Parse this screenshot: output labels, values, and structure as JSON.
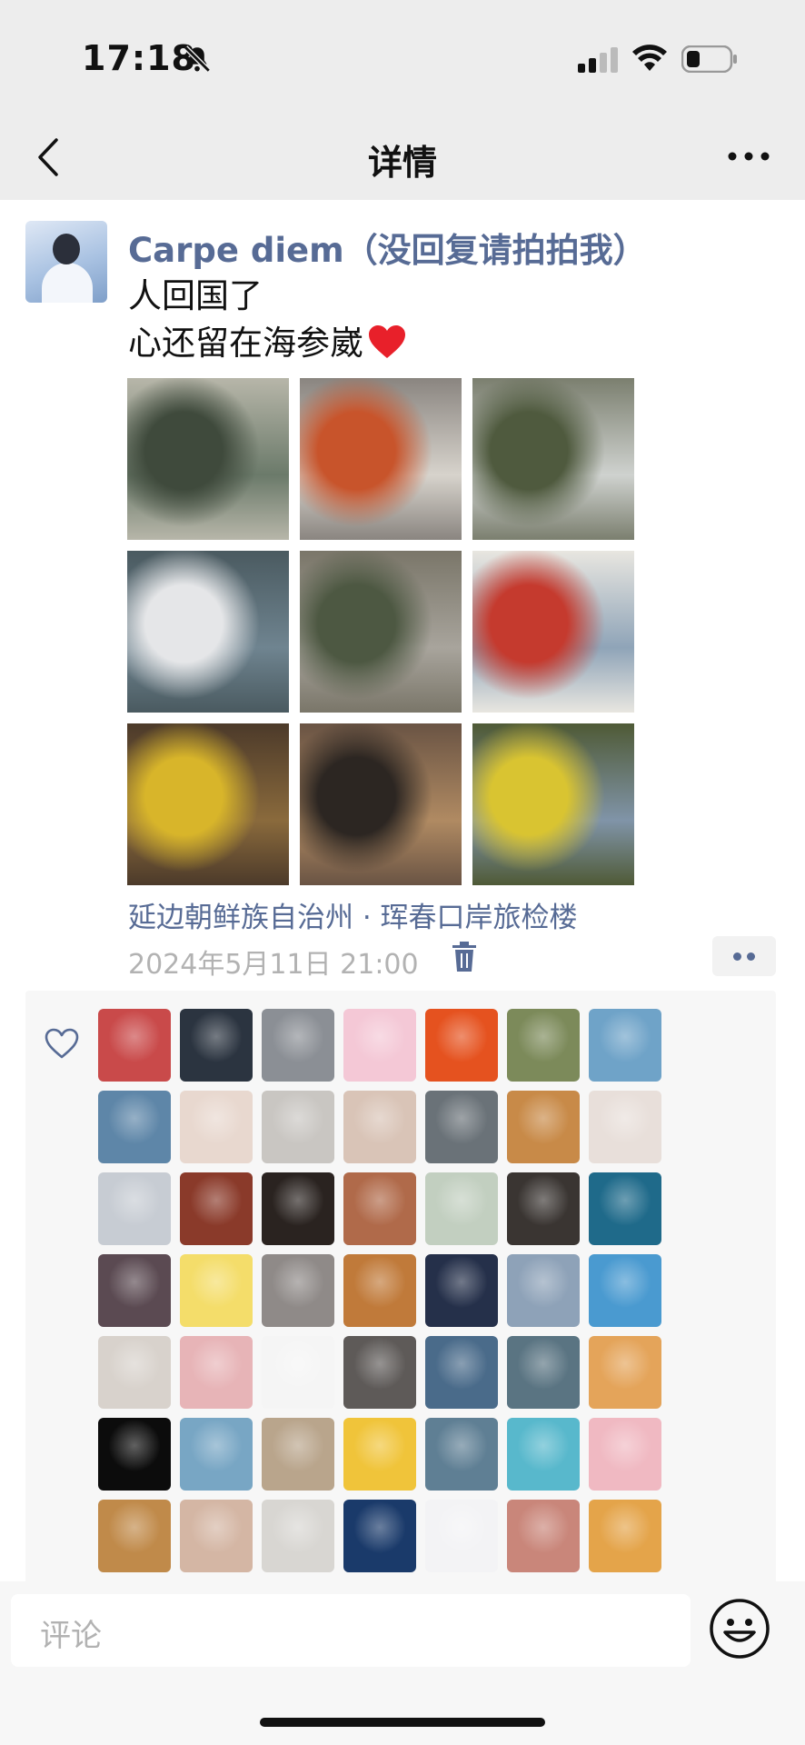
{
  "status_bar": {
    "time": "17:18"
  },
  "nav": {
    "title": "详情"
  },
  "post": {
    "user_name": "Carpe diem（没回复请拍拍我）",
    "text_lines": [
      "人回国了",
      "心还留在海参崴"
    ],
    "location": "延边朝鲜族自治州 · 珲春口岸旅检楼",
    "time": "2024年5月11日 21:00",
    "photos": [
      {
        "name": "soldier-tank-photo",
        "colors": [
          "#6b7a6a",
          "#3f4a3c",
          "#b7b6a9"
        ]
      },
      {
        "name": "crab-legs-photo",
        "colors": [
          "#d7d3cc",
          "#c8542b",
          "#8a8580"
        ]
      },
      {
        "name": "military-truck-photo",
        "colors": [
          "#cfd2cf",
          "#4f5a3e",
          "#7b7f6f"
        ]
      },
      {
        "name": "navy-parade-photo",
        "colors": [
          "#6f8490",
          "#e5e6e8",
          "#4a5a60"
        ]
      },
      {
        "name": "tank-parade-photo",
        "colors": [
          "#a8a49c",
          "#4d5842",
          "#7a7669"
        ]
      },
      {
        "name": "vintage-car-parade-photo",
        "colors": [
          "#8fa4b8",
          "#c53a2e",
          "#e8e6e0"
        ]
      },
      {
        "name": "street-cafe-photo",
        "colors": [
          "#8a6a3c",
          "#d8b52a",
          "#4c3a2a"
        ]
      },
      {
        "name": "woman-leather-jacket-photo",
        "colors": [
          "#b08a62",
          "#2c2622",
          "#6a5444"
        ]
      },
      {
        "name": "scooters-statue-photo",
        "colors": [
          "#8094a8",
          "#d9c431",
          "#4f5a36"
        ]
      }
    ]
  },
  "likes": {
    "avatars": [
      "#c94a4a",
      "#2b3440",
      "#8b8f95",
      "#f4c8d6",
      "#e5521f",
      "#7c8a5a",
      "#6fa3c8",
      "#5e86a8",
      "#e8d8cf",
      "#c9c6c2",
      "#d9c4b7",
      "#6a7278",
      "#c88a48",
      "#e8dfda",
      "#c7ccd3",
      "#8a3a2a",
      "#2a2320",
      "#b06a4a",
      "#c2cfc0",
      "#3a3532",
      "#1f6a8a",
      "#5b4a52",
      "#f4dd6a",
      "#8f8a88",
      "#c07a3a",
      "#25304a",
      "#8ea2b8",
      "#4a9ad0",
      "#d8d2cc",
      "#e7b4b7",
      "#f5f5f5",
      "#5e5a58",
      "#4a6b8a",
      "#5a7482",
      "#e4a45a",
      "#0c0c0c",
      "#78a6c4",
      "#b9a58c",
      "#f0c43a",
      "#5f7f94",
      "#58b8cc",
      "#f0b9c2",
      "#c08a4a",
      "#d4b6a4",
      "#d8d6d2",
      "#1a3a6a",
      "#f3f3f5",
      "#c9867a",
      "#e4a44a"
    ]
  },
  "comment": {
    "placeholder": "评论"
  },
  "icons": {
    "back": "chevron-left-icon",
    "more": "more-dots-icon",
    "mute": "bell-slash-icon",
    "trash": "trash-icon",
    "like": "heart-outline-icon",
    "emoji": "smiley-icon"
  },
  "colors": {
    "link": "#576b95",
    "nav_bg": "#ededed",
    "meta_gray": "#b2b2b2"
  }
}
